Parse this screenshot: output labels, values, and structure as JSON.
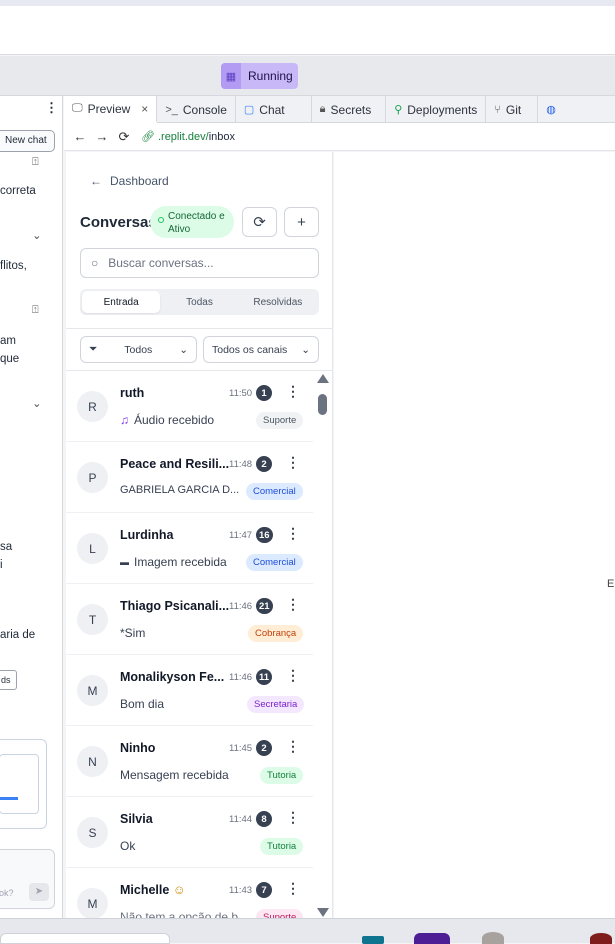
{
  "runbar": {
    "run_label": "Running"
  },
  "left_panel": {
    "new_chat": "New chat",
    "snippets": [
      "correta",
      "flitos,",
      "am",
      "que",
      "sa",
      "i",
      "aria de",
      "ds",
      "ok?"
    ]
  },
  "tabs": [
    {
      "label": "Preview",
      "icon": "monitor-icon",
      "closable": true
    },
    {
      "label": "Console",
      "icon": "terminal-icon"
    },
    {
      "label": "Chat",
      "icon": "chat-bubble-icon"
    },
    {
      "label": "Secrets",
      "icon": "lock-icon"
    },
    {
      "label": "Deployments",
      "icon": "deploy-icon"
    },
    {
      "label": "Git",
      "icon": "git-icon"
    }
  ],
  "url": {
    "domain": ".replit.dev/",
    "path": "inbox"
  },
  "app": {
    "back_label": "Dashboard",
    "title": "Conversas",
    "status_text": "Conectado e Ativo",
    "search_placeholder": "Buscar conversas...",
    "segments": [
      "Entrada",
      "Todas",
      "Resolvidas"
    ],
    "active_segment": "Entrada",
    "filter_status": "Todos",
    "filter_channel": "Todos os canais",
    "conversations": [
      {
        "initial": "R",
        "name": "ruth",
        "time": "11:50",
        "count": "1",
        "preview": "Áudio recebido",
        "preview_icon": "music-note-icon",
        "tag": "Suporte"
      },
      {
        "initial": "P",
        "name": "Peace and Resili...",
        "time": "11:48",
        "count": "2",
        "preview": "GABRIELA GARCIA D...",
        "tag": "Comercial"
      },
      {
        "initial": "L",
        "name": "Lurdinha",
        "time": "11:47",
        "count": "16",
        "preview": "Imagem recebida",
        "preview_icon": "camera-icon",
        "tag": "Comercial"
      },
      {
        "initial": "T",
        "name": "Thiago Psicanali...",
        "time": "11:46",
        "count": "21",
        "preview": "*Sim",
        "tag": "Cobrança"
      },
      {
        "initial": "M",
        "name": "Monalikyson Fe...",
        "time": "11:46",
        "count": "11",
        "preview": "Bom dia",
        "tag": "Secretaria"
      },
      {
        "initial": "N",
        "name": "Ninho",
        "time": "11:45",
        "count": "2",
        "preview": "Mensagem recebida",
        "tag": "Tutoria"
      },
      {
        "initial": "S",
        "name": "Silvia",
        "time": "11:44",
        "count": "8",
        "preview": "Ok",
        "tag": "Tutoria"
      },
      {
        "initial": "M",
        "name": "Michelle",
        "name_icon": "emoji-icon",
        "time": "11:43",
        "count": "7",
        "preview": "Não tem a opção de b...",
        "tag": "Suporte"
      }
    ]
  },
  "tag_colors": {
    "Suporte": {
      "bg": "#f1f2f4",
      "fg": "#4b5563"
    },
    "Comercial": {
      "bg": "#dbeafe",
      "fg": "#1d4ed8"
    },
    "Cobrança": {
      "bg": "#ffedd5",
      "fg": "#c2410c"
    },
    "Secretaria": {
      "bg": "#f3e8ff",
      "fg": "#7e22ce"
    },
    "Tutoria": {
      "bg": "#dcfce7",
      "fg": "#15803d"
    }
  },
  "edge_letter": "E"
}
